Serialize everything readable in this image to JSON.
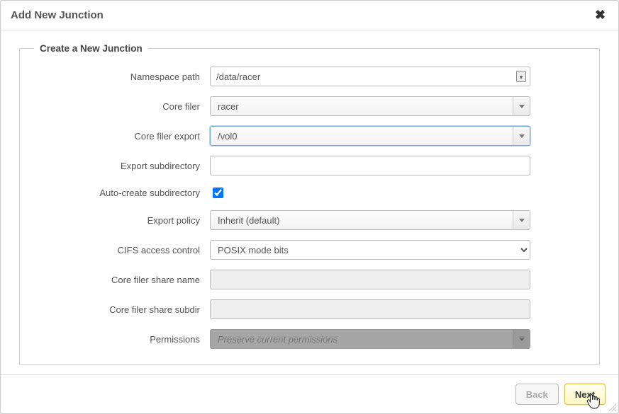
{
  "dialog": {
    "title": "Add New Junction",
    "close_label": "✖"
  },
  "fieldset": {
    "legend": "Create a New Junction"
  },
  "form": {
    "namespace_path": {
      "label": "Namespace path",
      "value": "/data/racer"
    },
    "core_filer": {
      "label": "Core filer",
      "value": "racer"
    },
    "core_filer_export": {
      "label": "Core filer export",
      "value": "/vol0"
    },
    "export_subdir": {
      "label": "Export subdirectory",
      "value": ""
    },
    "auto_create_subdir": {
      "label": "Auto-create subdirectory",
      "checked": true
    },
    "export_policy": {
      "label": "Export policy",
      "value": "Inherit (default)"
    },
    "cifs_access_control": {
      "label": "CIFS access control",
      "value": "POSIX mode bits"
    },
    "core_filer_share_name": {
      "label": "Core filer share name",
      "value": ""
    },
    "core_filer_share_subdir": {
      "label": "Core filer share subdir",
      "value": ""
    },
    "permissions": {
      "label": "Permissions",
      "value": "Preserve current permissions"
    }
  },
  "footer": {
    "back": "Back",
    "next": "Next"
  }
}
